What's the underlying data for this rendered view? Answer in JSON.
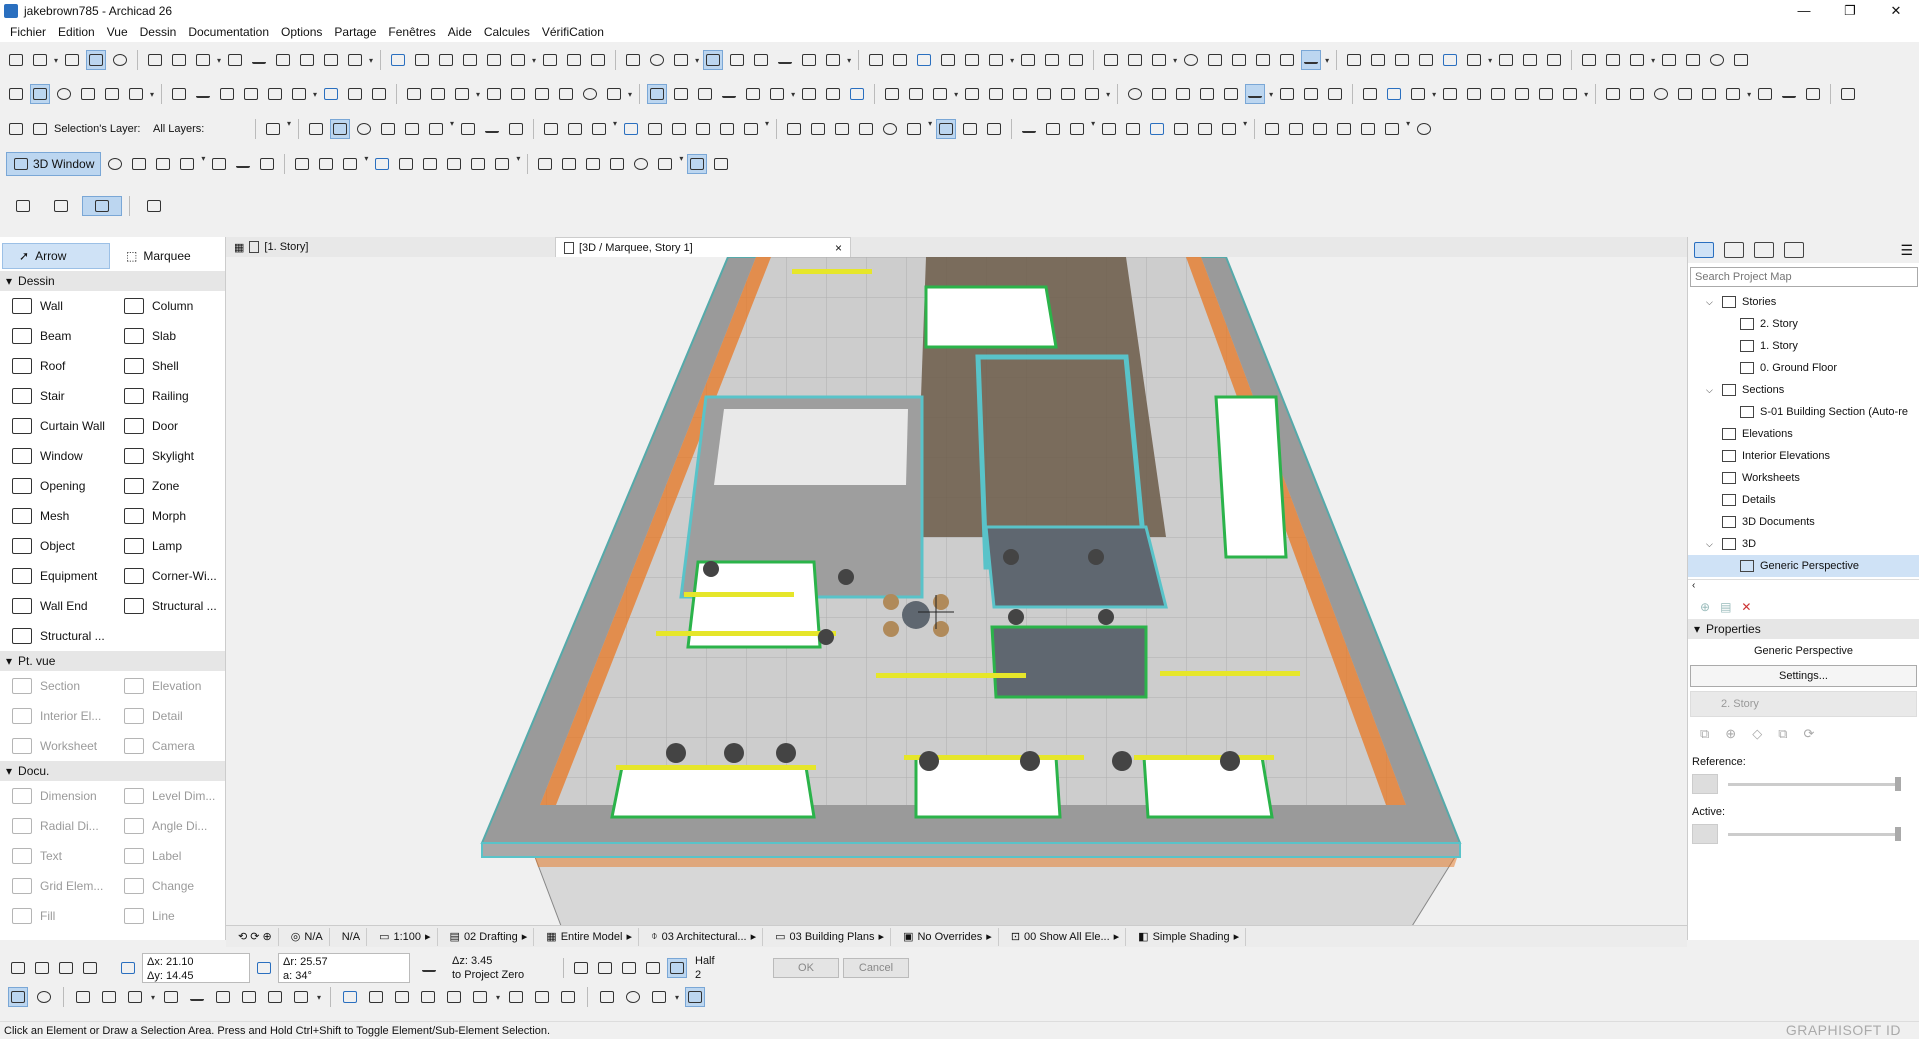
{
  "window": {
    "title": "jakebrown785 - Archicad 26",
    "min": "—",
    "max": "❐",
    "close": "✕"
  },
  "menu": [
    "Fichier",
    "Edition",
    "Vue",
    "Dessin",
    "Documentation",
    "Options",
    "Partage",
    "Fenêtres",
    "Aide",
    "Calcules",
    "VérifiCation"
  ],
  "layers": {
    "selection_label": "Selection's Layer:",
    "all_label": "All Layers:"
  },
  "toolbar": {
    "view3d_label": "3D Window"
  },
  "toolbox": {
    "arrow": "Arrow",
    "marquee": "Marquee",
    "dessin_title": "Dessin",
    "dessin": [
      "Wall",
      "Column",
      "Beam",
      "Slab",
      "Roof",
      "Shell",
      "Stair",
      "Railing",
      "Curtain Wall",
      "Door",
      "Window",
      "Skylight",
      "Opening",
      "Zone",
      "Mesh",
      "Morph",
      "Object",
      "Lamp",
      "Equipment",
      "Corner-Wi...",
      "Wall End",
      "Structural ...",
      "Structural ..."
    ],
    "ptvue_title": "Pt. vue",
    "ptvue": [
      "Section",
      "Elevation",
      "Interior El...",
      "Detail",
      "Worksheet",
      "Camera"
    ],
    "docu_title": "Docu.",
    "docu": [
      "Dimension",
      "Level Dim...",
      "Radial Di...",
      "Angle Di...",
      "Text",
      "Label",
      "Grid Elem...",
      "Change",
      "Fill",
      "Line"
    ]
  },
  "tabs": {
    "tab1": "[1. Story]",
    "tab2": "[3D / Marquee, Story 1]",
    "close": "×"
  },
  "bottombar": {
    "zoom1": "N/A",
    "zoom2": "N/A",
    "scale": "1:100",
    "pen": "02 Drafting",
    "model": "Entire Model",
    "struct": "03 Architectural...",
    "plans": "03 Building Plans",
    "overrides": "No Overrides",
    "show": "00 Show All Ele...",
    "shading": "Simple Shading"
  },
  "navigator": {
    "search_placeholder": "Search Project Map",
    "tree": [
      {
        "label": "Stories",
        "level": 1,
        "toggle": "⌵"
      },
      {
        "label": "2. Story",
        "level": 2
      },
      {
        "label": "1. Story",
        "level": 2
      },
      {
        "label": "0. Ground Floor",
        "level": 2
      },
      {
        "label": "Sections",
        "level": 1,
        "toggle": "⌵"
      },
      {
        "label": "S-01 Building Section (Auto-re",
        "level": 2
      },
      {
        "label": "Elevations",
        "level": 1
      },
      {
        "label": "Interior Elevations",
        "level": 1
      },
      {
        "label": "Worksheets",
        "level": 1
      },
      {
        "label": "Details",
        "level": 1
      },
      {
        "label": "3D Documents",
        "level": 1
      },
      {
        "label": "3D",
        "level": 1,
        "toggle": "⌵"
      },
      {
        "label": "Generic Perspective",
        "level": 2,
        "selected": true
      }
    ],
    "properties_title": "Properties",
    "properties_name": "Generic Perspective",
    "settings_btn": "Settings...",
    "story_disabled": "2. Story",
    "reference_label": "Reference:",
    "active_label": "Active:"
  },
  "infobox": {
    "dx": "Δx: 21.10",
    "dy": "Δy: 14.45",
    "dr": "Δr: 25.57",
    "da": "a: 34°",
    "dz": "Δz: 3.45",
    "proj": "to Project Zero",
    "half": "Half",
    "half_n": "2",
    "ok": "OK",
    "cancel": "Cancel"
  },
  "status": {
    "text": "Click an Element or Draw a Selection Area. Press and Hold Ctrl+Shift to Toggle Element/Sub-Element Selection.",
    "brand": "GRAPHISOFT ID"
  },
  "colors": {
    "accent": "#2a6fbf",
    "wall_edge": "#59c3c9",
    "wall": "#a9a9a9",
    "glass": "#e87722",
    "desk_frame": "#2bb34a",
    "floor": "#c9c9c9",
    "lamp": "#e6e62a",
    "wood": "#6b5a48"
  }
}
